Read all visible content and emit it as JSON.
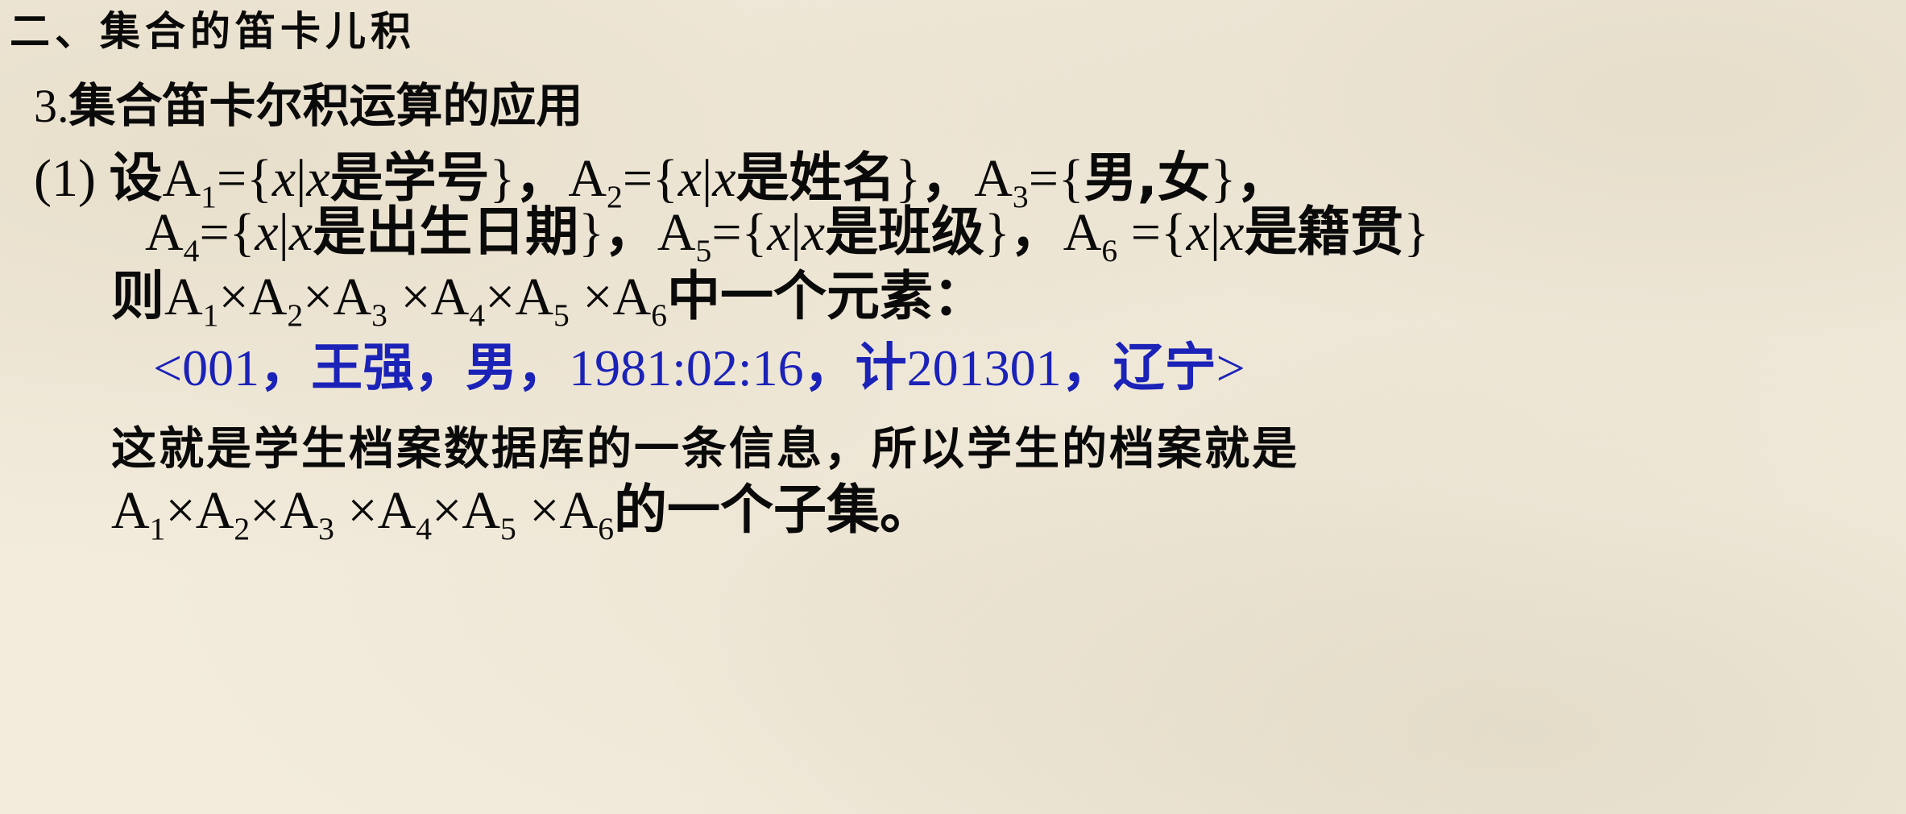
{
  "heading": "二、集合的笛卡儿积",
  "subheading": {
    "number": "3.",
    "text": "集合笛卡尔积运算的应用"
  },
  "item1": {
    "label": "(1)",
    "intro": "设",
    "comma": "，",
    "sets": [
      {
        "name": "A",
        "sub": "1",
        "eq": "={",
        "var": "x",
        "bar": "|",
        "var2": "x",
        "desc": "是学号",
        "close": "}"
      },
      {
        "name": "A",
        "sub": "2",
        "eq": "={",
        "var": "x",
        "bar": "|",
        "var2": "x",
        "desc": "是姓名",
        "close": "}"
      },
      {
        "name": "A",
        "sub": "3",
        "eq": "={",
        "desc": "男,女",
        "close": "}"
      },
      {
        "name": "A",
        "sub": "4",
        "eq": "={",
        "var": "x",
        "bar": "|",
        "var2": "x",
        "desc": "是出生日期",
        "close": "}"
      },
      {
        "name": "A",
        "sub": "5",
        "eq": "={",
        "var": "x",
        "bar": "|",
        "var2": "x",
        "desc": "是班级",
        "close": "}"
      },
      {
        "name": "A",
        "sub": "6",
        "eq": " ={",
        "var": "x",
        "bar": "|",
        "var2": "x",
        "desc": "是籍贯",
        "close": "}"
      }
    ]
  },
  "product_line": {
    "prefix": "则",
    "times": "×",
    "suffix": "中一个元素："
  },
  "tuple": {
    "open": "<",
    "id": "001",
    "sep": "，",
    "name": "王强",
    "gender": "男",
    "birth": "1981:02:16",
    "class_prefix": "计",
    "class_num": "201301",
    "origin": "辽宁",
    "close": ">"
  },
  "note": {
    "line1": "这就是学生档案数据库的一条信息，所以学生的档案就是",
    "suffix": "的一个子集。"
  }
}
